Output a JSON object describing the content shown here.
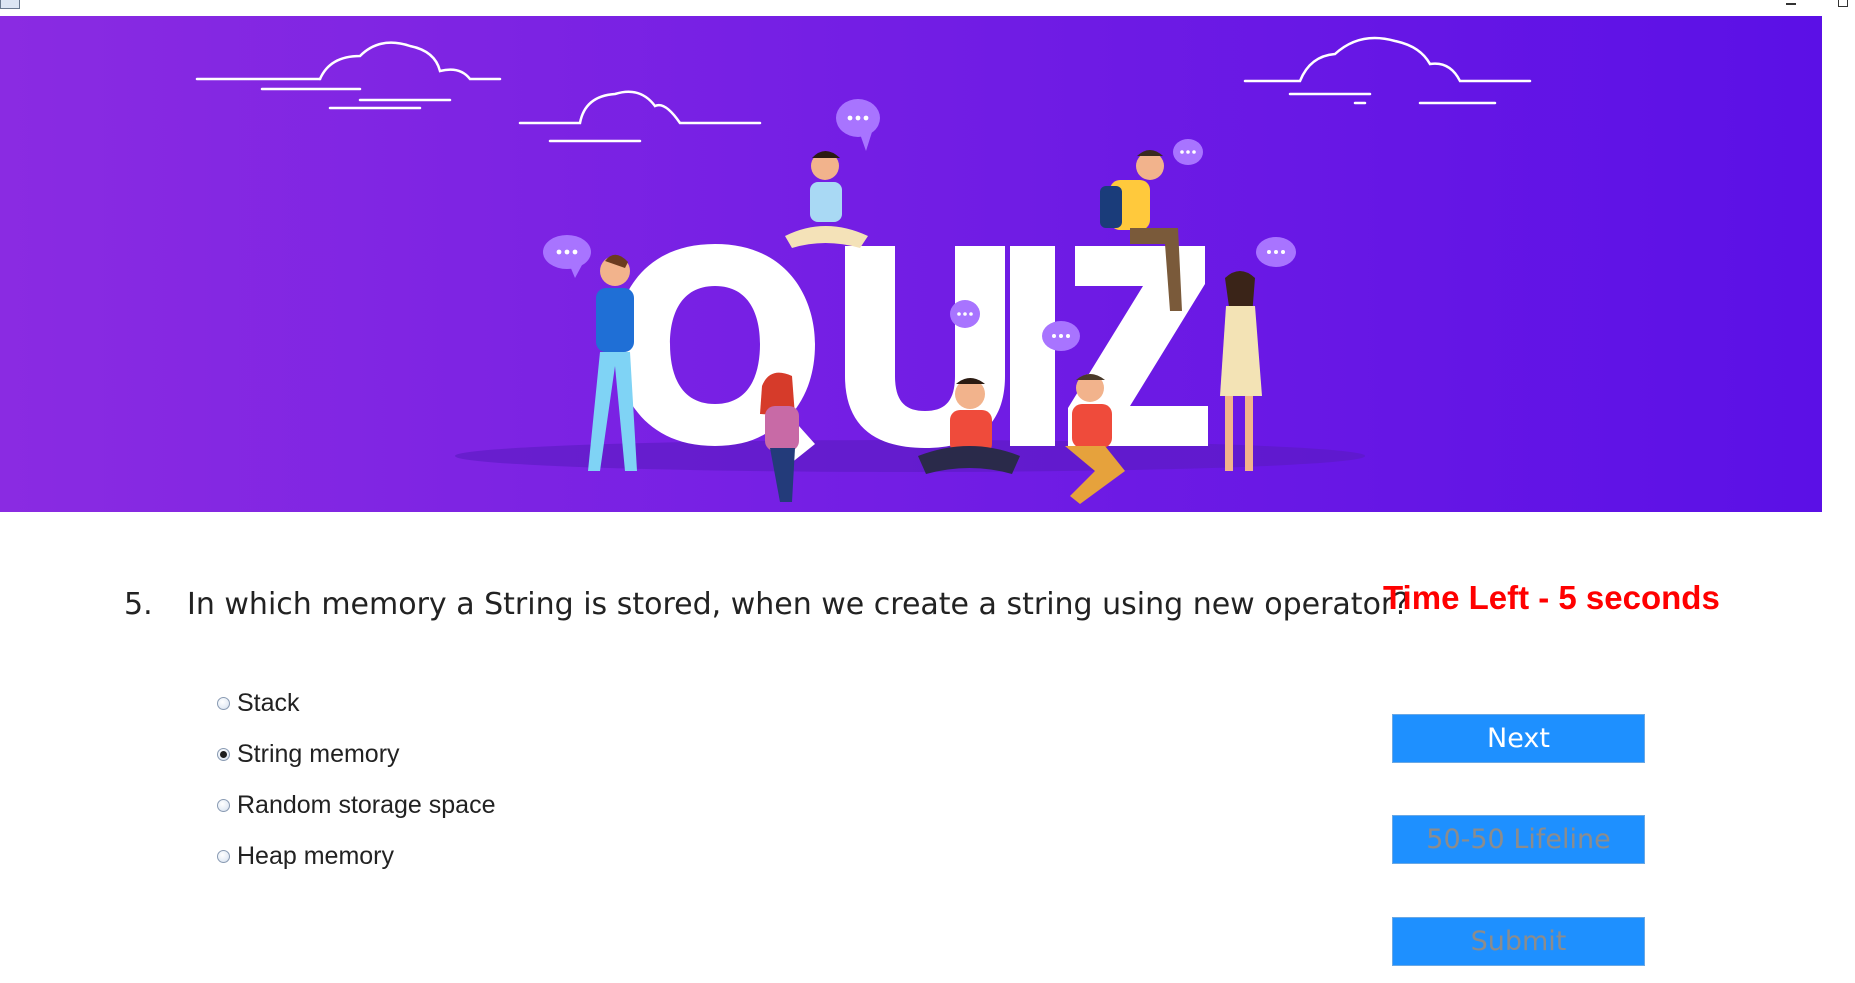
{
  "titlebar": {
    "icons": [
      "app-icon",
      "minimize-icon",
      "maximize-icon"
    ]
  },
  "banner": {
    "heading": "QUIZ",
    "colors": {
      "gradient_start": "#8a2be2",
      "gradient_end": "#5b10e6",
      "letters": "#ffffff",
      "bubble": "#a874ff"
    }
  },
  "question": {
    "number": "5.",
    "text": "In which memory a String is stored, when we create a string using new operator?"
  },
  "timer": {
    "text": "Time Left - 5 seconds",
    "color": "#ff0000"
  },
  "options": [
    {
      "label": "Stack",
      "selected": false
    },
    {
      "label": "String memory",
      "selected": true
    },
    {
      "label": "Random storage space",
      "selected": false
    },
    {
      "label": "Heap memory",
      "selected": false
    }
  ],
  "buttons": {
    "next": "Next",
    "lifeline": "50-50 Lifeline",
    "submit": "Submit",
    "color": "#1e90ff"
  }
}
